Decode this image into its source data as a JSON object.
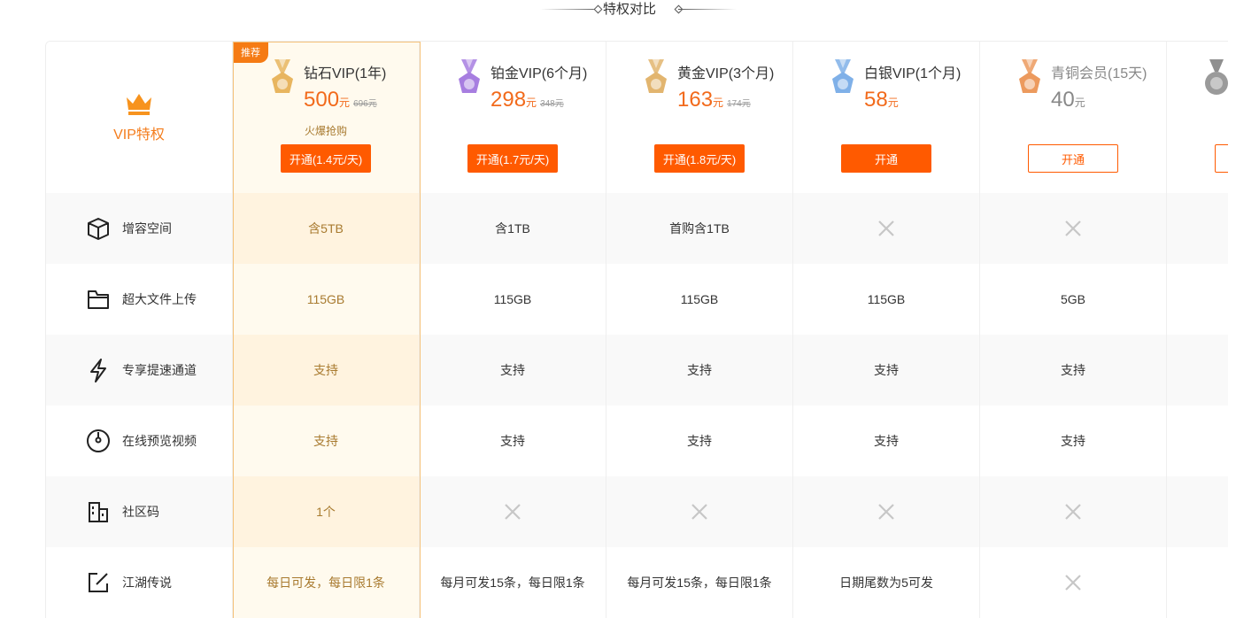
{
  "section_title": "特权对比",
  "header": {
    "vip_label": "VIP特权",
    "recommend_badge": "推荐",
    "plans": [
      {
        "name": "钻石VIP(1年)",
        "price": "500",
        "unit": "元",
        "orig": "696元",
        "hot": "火爆抢购",
        "btn": "开通(1.4元/天)",
        "medal_color": "#e8b55f",
        "style": "filled"
      },
      {
        "name": "铂金VIP(6个月)",
        "price": "298",
        "unit": "元",
        "orig": "348元",
        "hot": "",
        "btn": "开通(1.7元/天)",
        "medal_color": "#a77ee0",
        "style": "filled"
      },
      {
        "name": "黄金VIP(3个月)",
        "price": "163",
        "unit": "元",
        "orig": "174元",
        "hot": "",
        "btn": "开通(1.8元/天)",
        "medal_color": "#e2b56f",
        "style": "filled"
      },
      {
        "name": "白银VIP(1个月)",
        "price": "58",
        "unit": "元",
        "orig": "",
        "hot": "",
        "btn": "开通",
        "medal_color": "#7fb0e8",
        "style": "filled"
      },
      {
        "name": "青铜会员(15天)",
        "price": "40",
        "unit": "元",
        "orig": "",
        "hot": "",
        "btn": "开通",
        "medal_color": "#ec9a5e",
        "style": "outline"
      }
    ]
  },
  "features": [
    {
      "label": "增容空间",
      "icon": "cube-icon",
      "values": [
        "含5TB",
        "含1TB",
        "首购含1TB",
        "x",
        "x",
        ""
      ]
    },
    {
      "label": "超大文件上传",
      "icon": "folder-icon",
      "values": [
        "115GB",
        "115GB",
        "115GB",
        "115GB",
        "5GB",
        ""
      ]
    },
    {
      "label": "专享提速通道",
      "icon": "lightning-icon",
      "values": [
        "支持",
        "支持",
        "支持",
        "支持",
        "支持",
        ""
      ]
    },
    {
      "label": "在线预览视频",
      "icon": "play-circle-icon",
      "values": [
        "支持",
        "支持",
        "支持",
        "支持",
        "支持",
        ""
      ]
    },
    {
      "label": "社区码",
      "icon": "building-icon",
      "values": [
        "1个",
        "x",
        "x",
        "x",
        "x",
        ""
      ]
    },
    {
      "label": "江湖传说",
      "icon": "edit-icon",
      "values": [
        "每日可发，每日限1条",
        "每月可发15条，每日限1条",
        "每月可发15条，每日限1条",
        "日期尾数为5可发",
        "x",
        ""
      ]
    }
  ],
  "colors": {
    "accent": "#ff5a00",
    "featured_bg": "#fffaee",
    "featured_border": "#f5c27a"
  }
}
